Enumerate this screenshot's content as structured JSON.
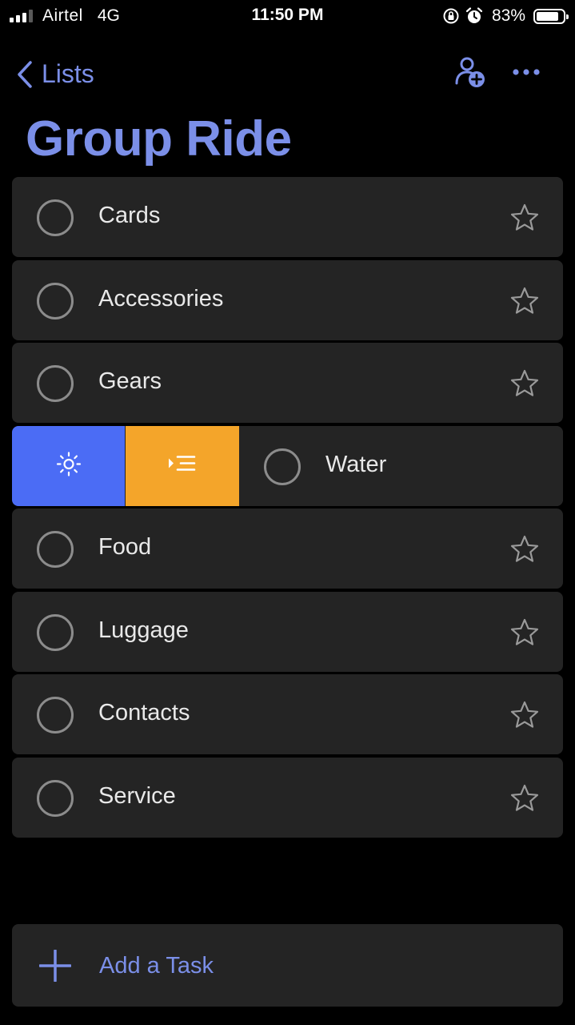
{
  "status_bar": {
    "carrier": "Airtel",
    "network": "4G",
    "time": "11:50 PM",
    "battery_percent": "83%",
    "battery_level": 0.83
  },
  "nav": {
    "back_label": "Lists"
  },
  "list": {
    "title": "Group Ride",
    "accent_color": "#7b8fe8"
  },
  "tasks": [
    {
      "title": "Cards"
    },
    {
      "title": "Accessories"
    },
    {
      "title": "Gears"
    },
    {
      "title": "Water",
      "swiped": true
    },
    {
      "title": "Food"
    },
    {
      "title": "Luggage"
    },
    {
      "title": "Contacts"
    },
    {
      "title": "Service"
    }
  ],
  "swipe_actions": [
    {
      "icon": "sun-icon",
      "color": "#4b6cf5"
    },
    {
      "icon": "move-to-list-icon",
      "color": "#f4a52a"
    }
  ],
  "add_task": {
    "label": "Add a Task"
  }
}
